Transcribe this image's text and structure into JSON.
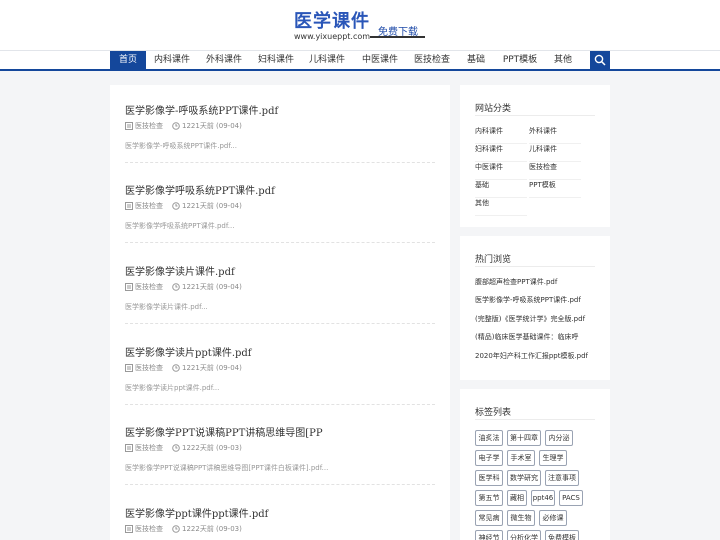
{
  "header": {
    "logo_title": "医学课件",
    "logo_url": "www.yixueppt.com",
    "free_download": "免费下载"
  },
  "nav": {
    "items": [
      "首页",
      "内科课件",
      "外科课件",
      "妇科课件",
      "儿科课件",
      "中医课件",
      "医技检查",
      "基础",
      "PPT模板",
      "其他"
    ],
    "active_index": 0,
    "search_icon": "search-icon"
  },
  "posts": [
    {
      "title": "医学影像学-呼吸系统PPT课件.pdf",
      "category": "医技检查",
      "time": "1221天前 (09-04)",
      "excerpt": "医学影像学-呼吸系统PPT课件.pdf..."
    },
    {
      "title": "医学影像学呼吸系统PPT课件.pdf",
      "category": "医技检查",
      "time": "1221天前 (09-04)",
      "excerpt": "医学影像学呼吸系统PPT课件.pdf..."
    },
    {
      "title": "医学影像学读片课件.pdf",
      "category": "医技检查",
      "time": "1221天前 (09-04)",
      "excerpt": "医学影像学读片课件.pdf..."
    },
    {
      "title": "医学影像学读片ppt课件.pdf",
      "category": "医技检查",
      "time": "1221天前 (09-04)",
      "excerpt": "医学影像学读片ppt课件.pdf..."
    },
    {
      "title": "医学影像学PPT说课稿PPT讲稿思维导图[PP",
      "category": "医技检查",
      "time": "1222天前 (09-03)",
      "excerpt": "医学影像学PPT说课稿PPT讲稿思维导图[PPT课件白板课件].pdf..."
    },
    {
      "title": "医学影像学ppt课件ppt课件.pdf",
      "category": "医技检查",
      "time": "1222天前 (09-03)",
      "excerpt": ""
    }
  ],
  "sidebar": {
    "categories": {
      "title": "网站分类",
      "items": [
        "内科课件",
        "外科课件",
        "妇科课件",
        "儿科课件",
        "中医课件",
        "医技检查",
        "基础",
        "PPT模板",
        "其他"
      ]
    },
    "hot": {
      "title": "热门浏览",
      "items": [
        "腹部超声检查PPT课件.pdf",
        "医学影像学-呼吸系统PPT课件.pdf",
        "(完整版)《医学统计学》完全版.pdf",
        "(精品)临床医学基础课件：临床呼",
        "2020年妇产科工作汇报ppt模板.pdf"
      ]
    },
    "tags": {
      "title": "标签列表",
      "items": [
        "油炙法",
        "第十四章",
        "内分泌",
        "电子学",
        "手术室",
        "生理学",
        "医学科",
        "数学研究",
        "注意事项",
        "第五节",
        "藏相",
        "ppt46",
        "PACS",
        "常见病",
        "微生物",
        "必修课",
        "神经节",
        "分析化学",
        "免费模板"
      ]
    }
  },
  "colors": {
    "brand_blue": "#14479b",
    "page_bg": "#f4f5f7"
  }
}
